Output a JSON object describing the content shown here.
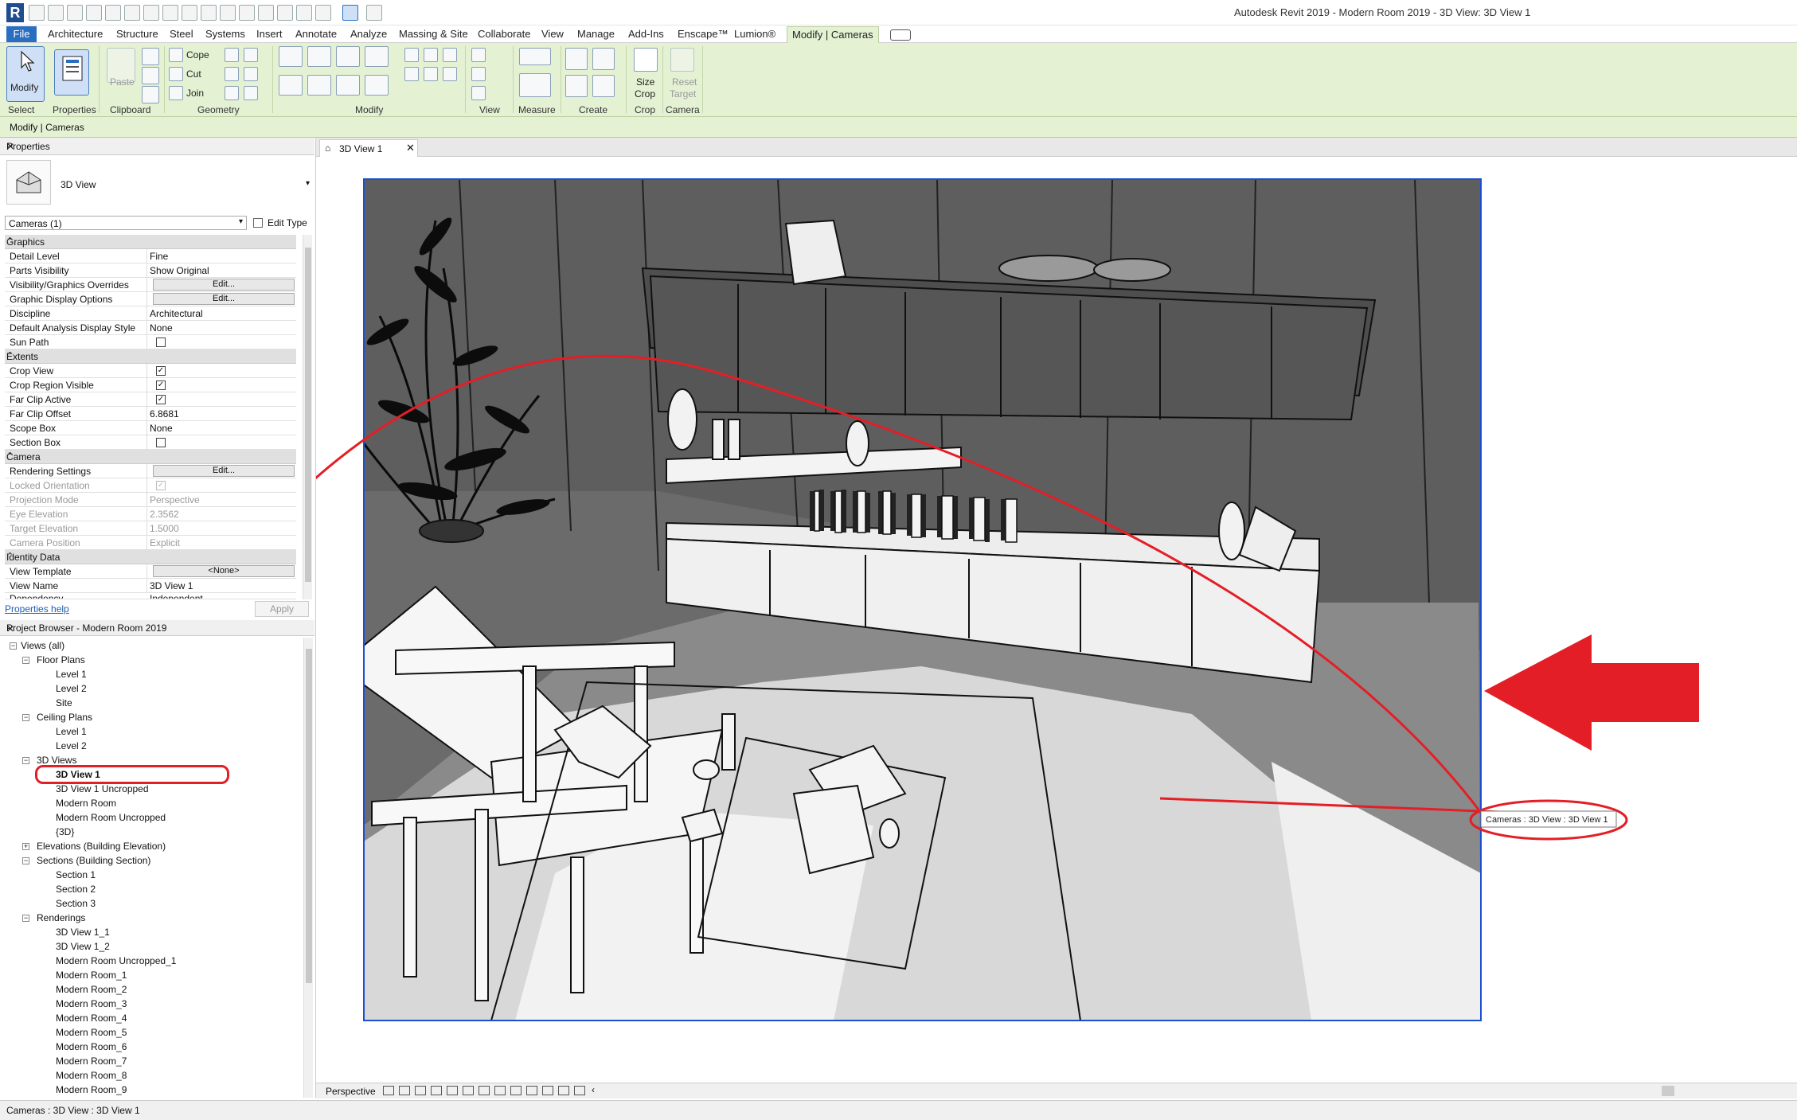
{
  "window": {
    "title": "Autodesk Revit 2019 - Modern Room 2019 - 3D View: 3D View 1"
  },
  "tabs": [
    "File",
    "Architecture",
    "Structure",
    "Steel",
    "Systems",
    "Insert",
    "Annotate",
    "Analyze",
    "Massing & Site",
    "Collaborate",
    "View",
    "Manage",
    "Add-Ins",
    "Enscape™",
    "Lumion®",
    "Modify | Cameras"
  ],
  "ribbon": {
    "modify_label": "Modify",
    "panels": {
      "select": "Select",
      "properties": "Properties",
      "clipboard": "Clipboard",
      "geometry": "Geometry",
      "modify": "Modify",
      "view": "View",
      "measure": "Measure",
      "create": "Create",
      "crop": "Crop",
      "camera": "Camera"
    },
    "paste_label": "Paste",
    "cope_label": "Cope",
    "cut_label": "Cut",
    "join_label": "Join",
    "size_crop_label1": "Size",
    "size_crop_label2": "Crop",
    "reset_target_label1": "Reset",
    "reset_target_label2": "Target"
  },
  "optionsbar": {
    "context": "Modify | Cameras"
  },
  "properties": {
    "header": "Properties",
    "type_name": "3D View",
    "selector": "Cameras (1)",
    "edit_type": "Edit Type",
    "groups": {
      "graphics": "Graphics",
      "extents": "Extents",
      "camera": "Camera",
      "identity": "Identity Data"
    },
    "rows": {
      "detail_level": {
        "k": "Detail Level",
        "v": "Fine"
      },
      "parts_visibility": {
        "k": "Parts Visibility",
        "v": "Show Original"
      },
      "vg_overrides": {
        "k": "Visibility/Graphics Overrides",
        "v": "Edit..."
      },
      "graphic_display": {
        "k": "Graphic Display Options",
        "v": "Edit..."
      },
      "discipline": {
        "k": "Discipline",
        "v": "Architectural"
      },
      "analysis_style": {
        "k": "Default Analysis Display Style",
        "v": "None"
      },
      "sun_path": {
        "k": "Sun Path"
      },
      "crop_view": {
        "k": "Crop View"
      },
      "crop_region_visible": {
        "k": "Crop Region Visible"
      },
      "far_clip_active": {
        "k": "Far Clip Active"
      },
      "far_clip_offset": {
        "k": "Far Clip Offset",
        "v": "6.8681"
      },
      "scope_box": {
        "k": "Scope Box",
        "v": "None"
      },
      "section_box": {
        "k": "Section Box"
      },
      "rendering_settings": {
        "k": "Rendering Settings",
        "v": "Edit..."
      },
      "locked_orientation": {
        "k": "Locked Orientation"
      },
      "projection_mode": {
        "k": "Projection Mode",
        "v": "Perspective"
      },
      "eye_elevation": {
        "k": "Eye Elevation",
        "v": "2.3562"
      },
      "target_elevation": {
        "k": "Target Elevation",
        "v": "1.5000"
      },
      "camera_position": {
        "k": "Camera Position",
        "v": "Explicit"
      },
      "view_template": {
        "k": "View Template",
        "v": "<None>"
      },
      "view_name": {
        "k": "View Name",
        "v": "3D View 1"
      },
      "dependency": {
        "k": "Dependency",
        "v": "Independent"
      }
    },
    "help": "Properties help",
    "apply": "Apply"
  },
  "project_browser": {
    "header": "Project Browser - Modern Room 2019",
    "items": [
      "Views (all)",
      "Floor Plans",
      "Level 1",
      "Level 2",
      "Site",
      "Ceiling Plans",
      "Level 1",
      "Level 2",
      "3D Views",
      "3D View 1",
      "3D View 1 Uncropped",
      "Modern Room",
      "Modern Room Uncropped",
      "{3D}",
      "Elevations (Building Elevation)",
      "Sections (Building Section)",
      "Section 1",
      "Section 2",
      "Section 3",
      "Renderings",
      "3D View 1_1",
      "3D View 1_2",
      "Modern Room Uncropped_1",
      "Modern Room_1",
      "Modern Room_2",
      "Modern Room_3",
      "Modern Room_4",
      "Modern Room_5",
      "Modern Room_6",
      "Modern Room_7",
      "Modern Room_8",
      "Modern Room_9"
    ]
  },
  "view": {
    "tab_label": "3D View 1",
    "tooltip": "Cameras : 3D View : 3D View 1",
    "status_mode": "Perspective"
  },
  "statusbar": {
    "text": "Cameras : 3D View : 3D View 1"
  },
  "colors": {
    "ribbon_bg": "#e4f1d3",
    "file_tab": "#2a6ec2",
    "crop_border": "#1a4fd0",
    "annotation_red": "#e41e26"
  }
}
